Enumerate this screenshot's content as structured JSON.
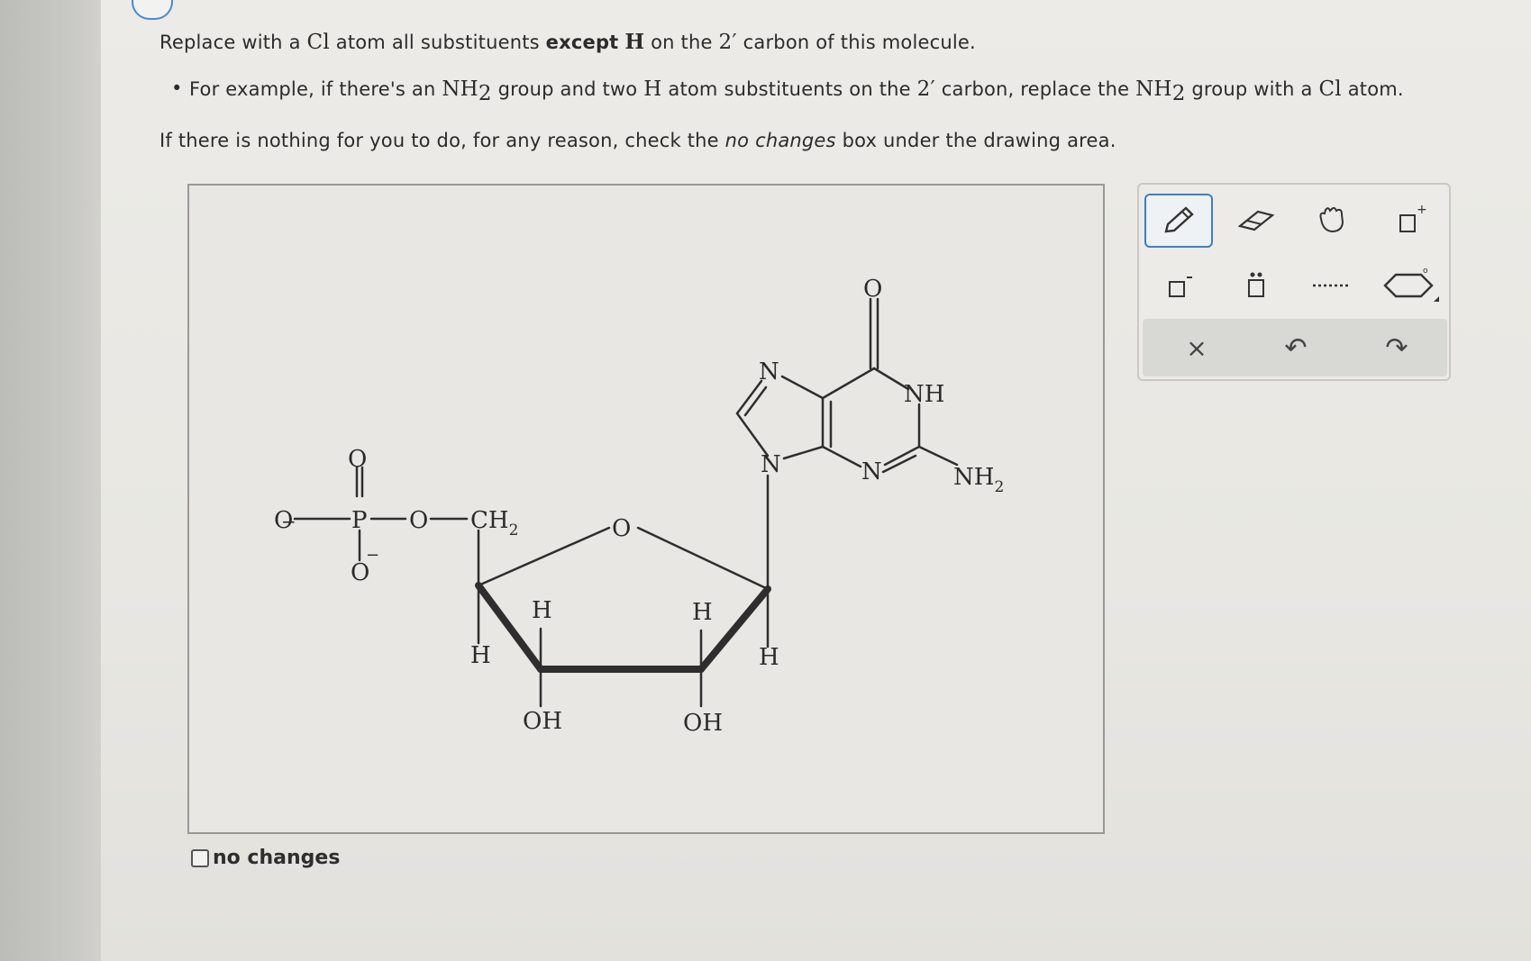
{
  "instructions": {
    "line1": {
      "pre": "Replace with a ",
      "cl": "Cl",
      "mid": " atom all substituents ",
      "bold": "except",
      "h": "H",
      "post": " on the ",
      "pos": "2′",
      "end": " carbon of this molecule."
    },
    "line2": {
      "bullet": "•",
      "a": "For example, if there's an ",
      "nh": "NH",
      "sub": "2",
      "b": " group and two ",
      "h": "H",
      "c": " atom substituents on the ",
      "pos": "2′",
      "d": " carbon, replace the ",
      "nh2": "NH",
      "sub2": "2",
      "e": " group with a ",
      "cl": "Cl",
      "f": " atom."
    },
    "line3": {
      "a": "If there is nothing for you to do, for any reason, check the ",
      "em": "no changes",
      "b": " box under the drawing area."
    }
  },
  "molecule": {
    "phosphate": {
      "o_top": "O",
      "o_left": "O",
      "p": "P",
      "o_bridge": "O",
      "ch2": "CH",
      "ch2_sub": "2",
      "o_bottom": "O",
      "minus_left": "−",
      "minus_bottom": "−"
    },
    "ring": {
      "o": "O",
      "h1": "H",
      "h2": "H",
      "h3": "H",
      "h4": "H",
      "oh2": "OH",
      "oh3": "OH"
    },
    "base": {
      "o": "O",
      "nh": "NH",
      "nh2": "NH",
      "nh2_sub": "2",
      "n7": "N",
      "n9": "N",
      "n3": "N"
    }
  },
  "no_changes": {
    "label": "no changes",
    "checked": false
  },
  "toolbar": {
    "tools": [
      "pencil-icon",
      "eraser-icon",
      "hand-icon",
      "charge-plus-icon",
      "charge-minus-icon",
      "lone-pair-icon",
      "radical-dots-icon",
      "ring-template-icon"
    ],
    "actions": {
      "clear": "×",
      "undo": "↶",
      "redo": "↷"
    },
    "selected": "pencil-icon"
  }
}
